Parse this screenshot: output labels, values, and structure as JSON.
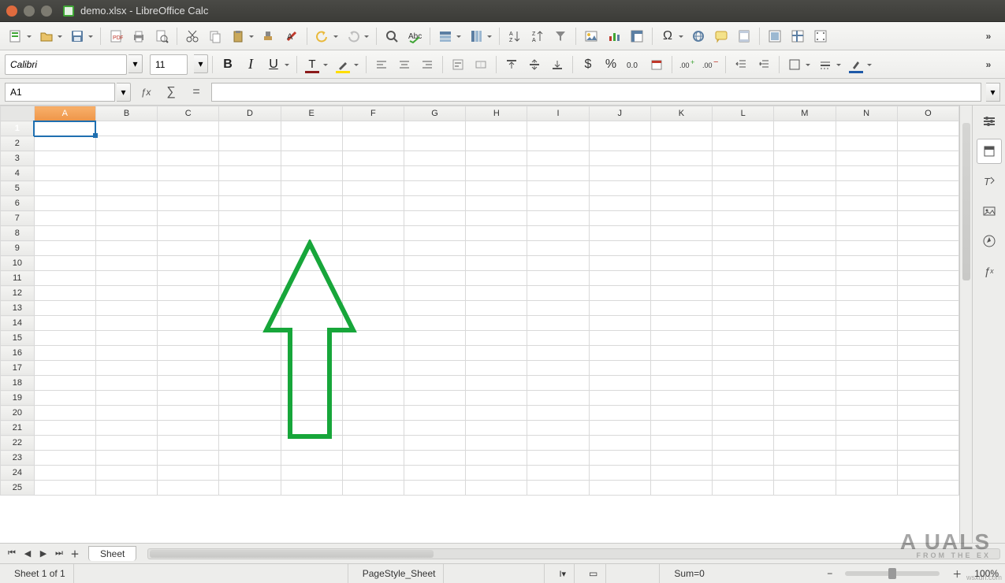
{
  "window": {
    "title": "demo.xlsx - LibreOffice Calc"
  },
  "toolbar": {
    "overflow": "»"
  },
  "format": {
    "font_name": "Calibri",
    "font_size": "11",
    "bold": "B",
    "italic": "I",
    "underline": "U",
    "font_color_glyph": "T",
    "highlight_glyph": "A",
    "font_color": "#8b1a1a",
    "highlight_color": "#ffde00",
    "currency": "$",
    "percent": "%",
    "overflow": "»"
  },
  "formula_bar": {
    "cell_ref": "A1",
    "fx": "ƒx",
    "sigma": "∑",
    "equals": "=",
    "value": ""
  },
  "columns": [
    "A",
    "B",
    "C",
    "D",
    "E",
    "F",
    "G",
    "H",
    "I",
    "J",
    "K",
    "L",
    "M",
    "N",
    "O"
  ],
  "rows_visible": 25,
  "active_cell": {
    "col": "A",
    "row": 1
  },
  "sheet_tabs": {
    "first": "⏮",
    "prev": "◀",
    "next": "▶",
    "last": "⏭",
    "add": "＋",
    "name": "Sheet"
  },
  "statusbar": {
    "sheet_pos": "Sheet 1 of 1",
    "page_style": "PageStyle_Sheet",
    "insert_mode": "I▾",
    "selection_mode": "▭",
    "sum": "Sum=0",
    "zoom_minus": "−",
    "zoom_plus": "＋",
    "zoom": "100%"
  },
  "sidepanel_hint": "≡",
  "watermark": {
    "big": "A  UALS",
    "small": "FROM THE EX",
    "site": "wsxdn.com"
  }
}
